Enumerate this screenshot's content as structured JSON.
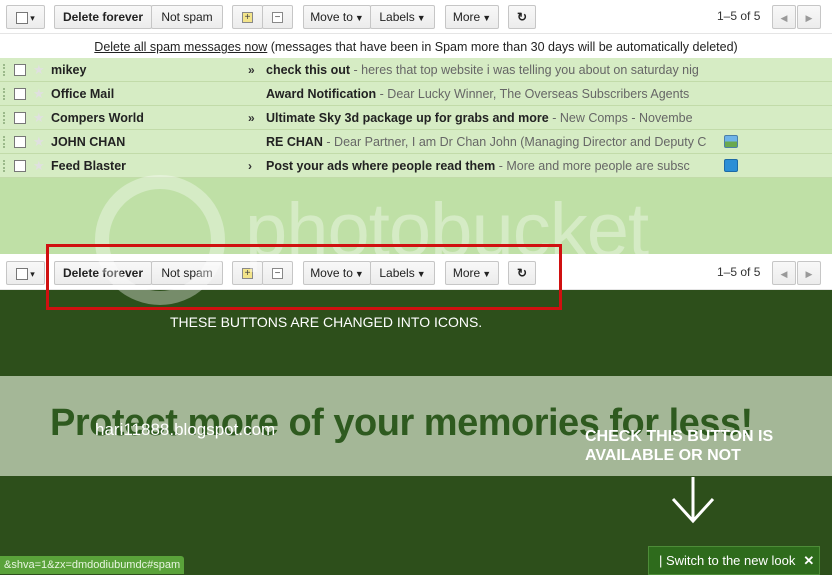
{
  "toolbar_top": {
    "select_caret": "▾",
    "delete_forever": "Delete forever",
    "not_spam": "Not spam",
    "move_to": "Move to",
    "labels": "Labels",
    "more": "More",
    "counter": "1–5 of 5"
  },
  "toolbar_bottom": {
    "select_caret": "▾",
    "delete_forever": "Delete forever",
    "not_spam": "Not spam",
    "move_to": "Move to",
    "labels": "Labels",
    "more": "More",
    "counter": "1–5 of 5"
  },
  "notice": {
    "link": "Delete all spam messages now",
    "text": " (messages that have been in Spam more than 30 days will be automatically deleted)"
  },
  "messages": [
    {
      "sender": "mikey",
      "mark": "»",
      "subject": "check this out",
      "snippet": " - heres that top website i was telling you about on saturday nig",
      "attachment": ""
    },
    {
      "sender": "Office Mail",
      "mark": "",
      "subject": "Award Notification",
      "snippet": " - Dear Lucky Winner, The Overseas Subscribers Agents",
      "attachment": ""
    },
    {
      "sender": "Compers World",
      "mark": "»",
      "subject": "Ultimate Sky 3d package up for grabs and more",
      "snippet": " - New Comps - Novembe",
      "attachment": ""
    },
    {
      "sender": "JOHN CHAN",
      "mark": "",
      "subject": "RE CHAN",
      "snippet": " - Dear Partner, I am Dr Chan John (Managing Director and Deputy C",
      "attachment": "image"
    },
    {
      "sender": "Feed Blaster",
      "mark": "›",
      "subject": "Post your ads where people read them",
      "snippet": " - More and more people are subsc",
      "attachment": "document"
    }
  ],
  "watermark": {
    "text": "photobucket"
  },
  "promo": {
    "headline": "Protect more of your memories for less!",
    "blog": "hari11888.blogspot.com"
  },
  "annotations": {
    "buttons_caption": "THESE BUTTONS ARE CHANGED INTO ICONS.",
    "check_caption": "CHECK THIS BUTTON IS\nAVAILABLE  OR NOT"
  },
  "statusbar": {
    "url": "&shva=1&zx=dmdodiubumdc#spam"
  },
  "switch_link": {
    "label": "| Switch to the new look",
    "close": "✕"
  },
  "colors": {
    "row_bg": "#d6ecc4",
    "list_bg": "#bfe0a6",
    "dark_bg": "#2d4f1b",
    "highlight_box": "#d01010"
  }
}
